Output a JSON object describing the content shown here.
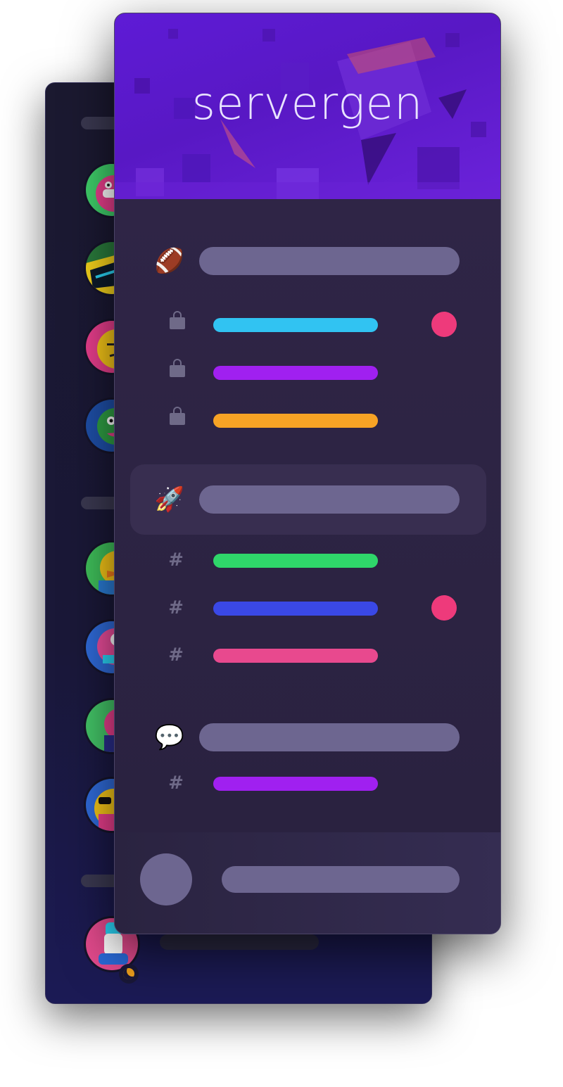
{
  "app": {
    "logo_text": "servergen"
  },
  "member_list": {
    "members": [
      {
        "icon": "pink-gamer-avatar",
        "bg": "#e83e8c"
      },
      {
        "icon": "green-shark-avatar",
        "bg": "#1f8f4a"
      },
      {
        "icon": "yellow-smirk-avatar",
        "bg": "#f5c518"
      },
      {
        "icon": "green-monster-avatar",
        "bg": "#2f9e44"
      },
      {
        "icon": "yellow-duck-avatar",
        "bg": "#3fbf5a"
      },
      {
        "icon": "pink-octopus-avatar",
        "bg": "#e94c9a"
      },
      {
        "icon": "pink-bird-avatar",
        "bg": "#43c467"
      },
      {
        "icon": "sunglasses-avatar",
        "bg": "#f4c518"
      },
      {
        "icon": "sneaker-avatar",
        "bg": "#e24a8c"
      }
    ],
    "self_status": "idle-moon-icon"
  },
  "categories": [
    {
      "emoji": "🏈",
      "icon": "football-icon",
      "active": false,
      "channels": [
        {
          "type": "locked",
          "color": "#31c3f2",
          "unread": true
        },
        {
          "type": "locked",
          "color": "#a020f0",
          "unread": false
        },
        {
          "type": "locked",
          "color": "#f7a325",
          "unread": false
        }
      ]
    },
    {
      "emoji": "🚀",
      "icon": "rocket-icon",
      "active": true,
      "channels": [
        {
          "type": "text",
          "glyph": "#",
          "color": "#2fd66a",
          "unread": false
        },
        {
          "type": "text",
          "glyph": "#",
          "color": "#3a48e6",
          "unread": true
        },
        {
          "type": "text",
          "glyph": "#",
          "color": "#e8498e",
          "unread": false
        }
      ]
    },
    {
      "emoji": "💬",
      "icon": "speech-bubble-icon",
      "active": false,
      "channels": [
        {
          "type": "text",
          "glyph": "#",
          "color": "#a020f0",
          "unread": false
        }
      ]
    }
  ],
  "colors": {
    "unread_badge": "#ee3a7b",
    "placeholder_pill": "#6d6690",
    "banner": "#5e1bd6"
  }
}
